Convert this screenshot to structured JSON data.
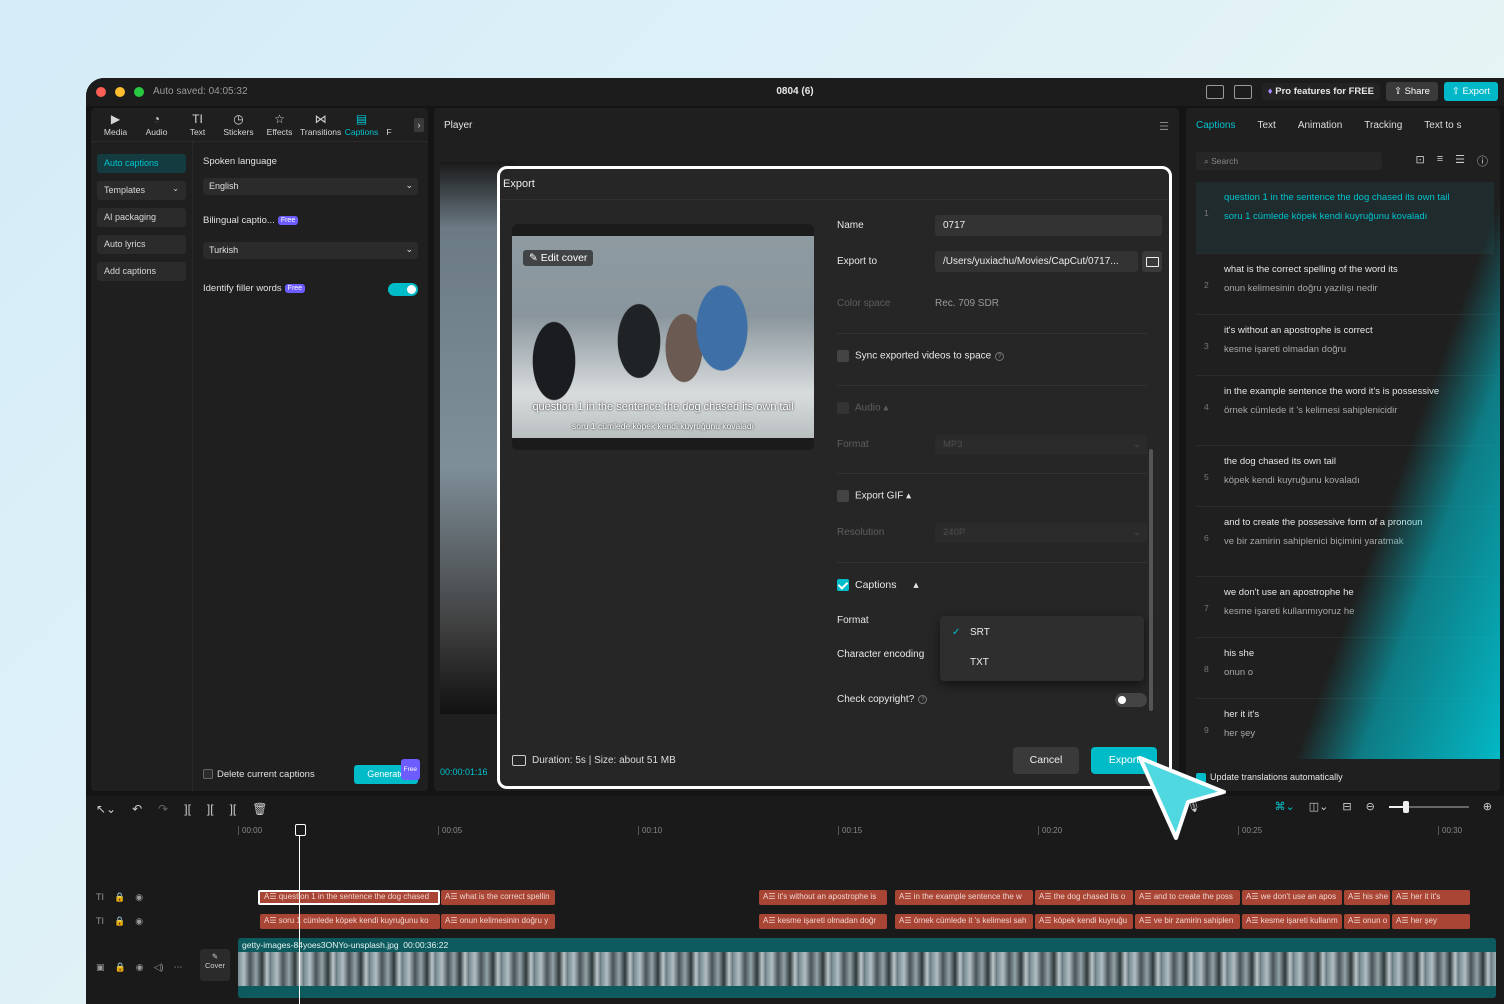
{
  "titlebar": {
    "autosave": "Auto saved: 04:05:32",
    "title": "0804 (6)",
    "pro_label": "Pro features for FREE",
    "share_label": "Share",
    "export_label": "Export"
  },
  "toolbar": {
    "tabs": [
      {
        "label": "Media",
        "icon": "media-icon"
      },
      {
        "label": "Audio",
        "icon": "audio-icon"
      },
      {
        "label": "Text",
        "icon": "text-icon"
      },
      {
        "label": "Stickers",
        "icon": "stickers-icon"
      },
      {
        "label": "Effects",
        "icon": "effects-icon"
      },
      {
        "label": "Transitions",
        "icon": "transitions-icon"
      },
      {
        "label": "Captions",
        "icon": "captions-icon"
      },
      {
        "label": "F",
        "icon": "filters-icon"
      }
    ]
  },
  "left_menu": {
    "items": [
      "Auto captions",
      "Templates",
      "AI packaging",
      "Auto lyrics",
      "Add captions"
    ]
  },
  "caption_settings": {
    "spoken_language_label": "Spoken language",
    "spoken_language_value": "English",
    "bilingual_label": "Bilingual captio...",
    "free_badge": "Free",
    "bilingual_value": "Turkish",
    "filler_label": "Identify filler words",
    "delete_label": "Delete current captions",
    "generate_label": "Generate"
  },
  "player": {
    "title": "Player",
    "time": "00:00:01:16"
  },
  "right_panel": {
    "tabs": [
      "Captions",
      "Text",
      "Animation",
      "Tracking",
      "Text to s"
    ],
    "search_placeholder": "Search",
    "captions": [
      {
        "num": "1",
        "en": "question 1 in the sentence the dog chased its own tail",
        "tr": "soru 1 cümlede köpek kendi kuyruğunu kovaladı"
      },
      {
        "num": "2",
        "en": "what is the correct spelling of the word its",
        "tr": "onun kelimesinin doğru yazılışı nedir"
      },
      {
        "num": "3",
        "en": "it's without an apostrophe is correct",
        "tr": "kesme işareti olmadan doğru"
      },
      {
        "num": "4",
        "en": "in the example sentence the word it's is possessive",
        "tr": "örnek cümlede it 's kelimesi sahiplenicidir"
      },
      {
        "num": "5",
        "en": "the dog chased its own tail",
        "tr": "köpek kendi kuyruğunu kovaladı"
      },
      {
        "num": "6",
        "en": "and to create the possessive form of a pronoun",
        "tr": "ve bir zamirin sahiplenici biçimini yaratmak"
      },
      {
        "num": "7",
        "en": "we don't use an apostrophe he",
        "tr": "kesme işareti kullanmıyoruz he"
      },
      {
        "num": "8",
        "en": "his she",
        "tr": "onun o"
      },
      {
        "num": "9",
        "en": "her it it's",
        "tr": "her şey"
      }
    ],
    "update_label": "Update translations automatically"
  },
  "timeline": {
    "ruler": [
      "00:00",
      "00:05",
      "00:10",
      "00:15",
      "00:20",
      "00:25",
      "00:30"
    ],
    "cover_label": "Cover",
    "track1": [
      "question 1 in the sentence the dog chased",
      "what is the correct spellin",
      "it's without an apostrophe is",
      "in the example sentence the w",
      "the dog chased its o",
      "and to create the poss",
      "we don't use an apos",
      "his she",
      "her it it's"
    ],
    "track2": [
      "soru 1 cümlede köpek kendi kuyruğunu ko",
      "onun kelimesinin doğru y",
      "kesme işareti olmadan doğr",
      "örnek cümlede it 's kelimesi sah",
      "köpek kendi kuyruğu",
      "ve bir zamirin sahiplen",
      "kesme işareti kullanm",
      "onun o",
      "her şey"
    ],
    "video_name": "getty-images-84yoes3ONYo-unsplash.jpg",
    "video_duration": "00:00:36:22"
  },
  "export_dialog": {
    "title": "Export",
    "edit_cover": "Edit cover",
    "preview_caption_en": "question 1 in the sentence the dog chased its own tail",
    "preview_caption_tr": "soru 1 cümlede köpek kendi kuyruğunu kovaladı",
    "name_label": "Name",
    "name_value": "0717",
    "export_to_label": "Export to",
    "export_to_value": "/Users/yuxiachu/Movies/CapCut/0717...",
    "color_space_label": "Color space",
    "color_space_value": "Rec. 709 SDR",
    "sync_label": "Sync exported videos to space",
    "audio_label": "Audio",
    "format_label_dim": "Format",
    "format_value_dim": "MP3",
    "gif_label": "Export GIF",
    "resolution_label": "Resolution",
    "resolution_value": "240P",
    "captions_label": "Captions",
    "format_label": "Format",
    "encoding_label": "Character encoding",
    "format_options": [
      "SRT",
      "TXT"
    ],
    "copyright_label": "Check copyright?",
    "duration_info": "Duration: 5s | Size: about 51 MB",
    "cancel_label": "Cancel",
    "export_label": "Export"
  }
}
